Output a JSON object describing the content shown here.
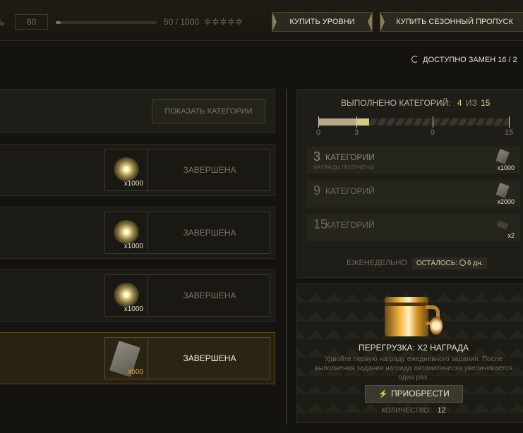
{
  "topbar": {
    "level_label": "ь",
    "level_value": "60",
    "xp_progress": 0.05,
    "xp_text": "50 / 1000",
    "xp_stars": "✲✲✲✲✲",
    "buy_levels": "КУПИТЬ УРОВНИ",
    "buy_pass": "КУПИТЬ СЕЗОННЫЙ ПРОПУСК"
  },
  "swaps": {
    "text": "ДОСТУПНО ЗАМЕН 16 / 2"
  },
  "left": {
    "show_categories": "ПОКАЗАТЬ КАТЕГОРИИ",
    "tasks": [
      {
        "reward_icon": "glow-orb-icon",
        "count": "x1000",
        "status": "ЗАВЕРШЕНА"
      },
      {
        "reward_icon": "glow-orb-icon",
        "count": "x1000",
        "status": "ЗАВЕРШЕНА"
      },
      {
        "reward_icon": "glow-orb-icon",
        "count": "x1000",
        "status": "ЗАВЕРШЕНА"
      },
      {
        "reward_icon": "ticket-icon",
        "count": "x500",
        "status": "ЗАВЕРШЕНА"
      }
    ]
  },
  "categories": {
    "title_prefix": "ВЫПОЛНЕНО КАТЕГОРИЙ:",
    "done": "4",
    "of": "ИЗ",
    "total": "15",
    "progress_value": 4,
    "progress_max": 15,
    "ticks": [
      "0",
      "3",
      "9",
      "15"
    ],
    "rows": [
      {
        "num": "3",
        "word": "КАТЕГОРИИ",
        "sub": "НАГРАДЫ ПОЛУЧЕНЫ",
        "count": "x1000"
      },
      {
        "num": "9",
        "word": "КАТЕГОРИЙ",
        "sub": "",
        "count": "x2000"
      },
      {
        "num": "15",
        "word": "КАТЕГОРИЙ",
        "sub": "",
        "count": "x2"
      }
    ],
    "weekly": "ЕЖЕНЕДЕЛЬНО",
    "remaining_label": "ОСТАЛОСЬ:",
    "remaining_value": "6 дн."
  },
  "overload": {
    "title": "ПЕРЕГРУЗКА: X2 НАГРАДА",
    "desc": "Удвойте первую награду ежедневного задания. После выполнения задания награда автоматически увеличивается один раз.",
    "buy": "ПРИОБРЕСТИ",
    "qty_label": "КОЛИЧЕСТВО:",
    "qty_value": "12"
  }
}
